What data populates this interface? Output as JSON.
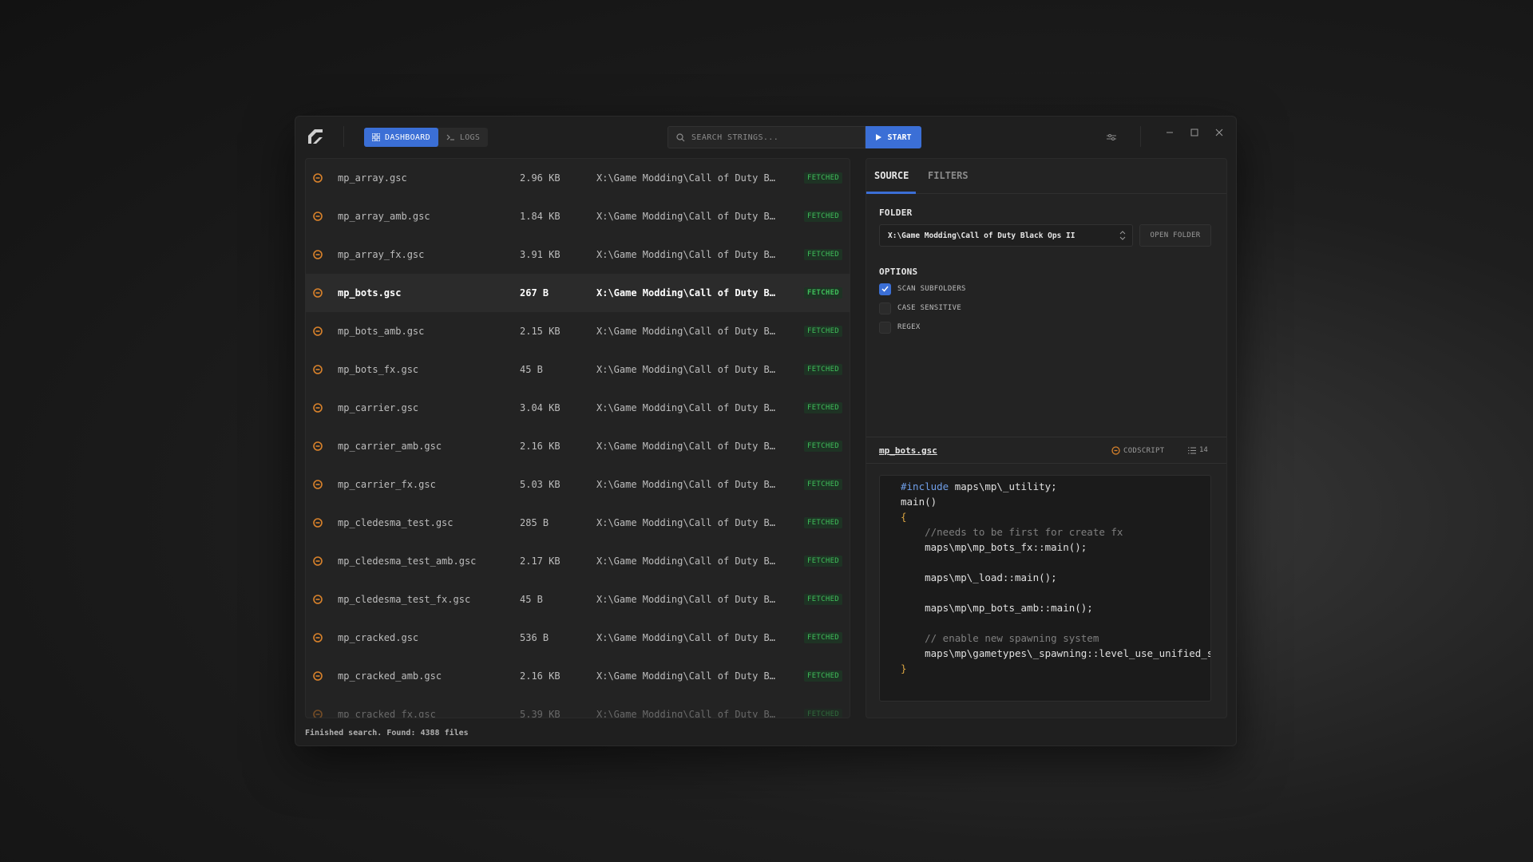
{
  "nav": {
    "dashboard_label": "DASHBOARD",
    "logs_label": "LOGS"
  },
  "search": {
    "placeholder": "SEARCH STRINGS...",
    "start_label": "START"
  },
  "files": [
    {
      "name": "mp_array.gsc",
      "size": "2.96 KB",
      "path": "X:\\Game Modding\\Call of Duty Black Ops II",
      "status": "FETCHED"
    },
    {
      "name": "mp_array_amb.gsc",
      "size": "1.84 KB",
      "path": "X:\\Game Modding\\Call of Duty Black Ops II",
      "status": "FETCHED"
    },
    {
      "name": "mp_array_fx.gsc",
      "size": "3.91 KB",
      "path": "X:\\Game Modding\\Call of Duty Black Ops II",
      "status": "FETCHED"
    },
    {
      "name": "mp_bots.gsc",
      "size": "267 B",
      "path": "X:\\Game Modding\\Call of Duty Black Ops II",
      "status": "FETCHED"
    },
    {
      "name": "mp_bots_amb.gsc",
      "size": "2.15 KB",
      "path": "X:\\Game Modding\\Call of Duty Black Ops II",
      "status": "FETCHED"
    },
    {
      "name": "mp_bots_fx.gsc",
      "size": "45 B",
      "path": "X:\\Game Modding\\Call of Duty Black Ops II",
      "status": "FETCHED"
    },
    {
      "name": "mp_carrier.gsc",
      "size": "3.04 KB",
      "path": "X:\\Game Modding\\Call of Duty Black Ops II",
      "status": "FETCHED"
    },
    {
      "name": "mp_carrier_amb.gsc",
      "size": "2.16 KB",
      "path": "X:\\Game Modding\\Call of Duty Black Ops II",
      "status": "FETCHED"
    },
    {
      "name": "mp_carrier_fx.gsc",
      "size": "5.03 KB",
      "path": "X:\\Game Modding\\Call of Duty Black Ops II",
      "status": "FETCHED"
    },
    {
      "name": "mp_cledesma_test.gsc",
      "size": "285 B",
      "path": "X:\\Game Modding\\Call of Duty Black Ops II",
      "status": "FETCHED"
    },
    {
      "name": "mp_cledesma_test_amb.gsc",
      "size": "2.17 KB",
      "path": "X:\\Game Modding\\Call of Duty Black Ops II",
      "status": "FETCHED"
    },
    {
      "name": "mp_cledesma_test_fx.gsc",
      "size": "45 B",
      "path": "X:\\Game Modding\\Call of Duty Black Ops II",
      "status": "FETCHED"
    },
    {
      "name": "mp_cracked.gsc",
      "size": "536 B",
      "path": "X:\\Game Modding\\Call of Duty Black Ops II",
      "status": "FETCHED"
    },
    {
      "name": "mp_cracked_amb.gsc",
      "size": "2.16 KB",
      "path": "X:\\Game Modding\\Call of Duty Black Ops II",
      "status": "FETCHED"
    },
    {
      "name": "mp_cracked_fx.gsc",
      "size": "5.39 KB",
      "path": "X:\\Game Modding\\Call of Duty Black Ops II",
      "status": "FETCHED"
    }
  ],
  "panel": {
    "tab_source": "SOURCE",
    "tab_filters": "FILTERS",
    "folder_label": "FOLDER",
    "folder_value": "X:\\Game Modding\\Call of Duty Black Ops II",
    "open_folder_label": "OPEN FOLDER",
    "options_label": "OPTIONS",
    "options": [
      {
        "label": "SCAN SUBFOLDERS",
        "checked": true
      },
      {
        "label": "CASE SENSITIVE",
        "checked": false
      },
      {
        "label": "REGEX",
        "checked": false
      }
    ]
  },
  "preview": {
    "file_name": "mp_bots.gsc",
    "language": "CODSCRIPT",
    "line_count": "14",
    "code": [
      {
        "text": "#include maps\\mp\\_utility;",
        "type": "include"
      },
      {
        "text": "main()",
        "type": "plain"
      },
      {
        "text": "{",
        "type": "brace"
      },
      {
        "text": "    //needs to be first for create fx",
        "type": "comment"
      },
      {
        "text": "    maps\\mp\\mp_bots_fx::main();",
        "type": "plain"
      },
      {
        "text": "",
        "type": "plain"
      },
      {
        "text": "    maps\\mp\\_load::main();",
        "type": "plain"
      },
      {
        "text": "",
        "type": "plain"
      },
      {
        "text": "    maps\\mp\\mp_bots_amb::main();",
        "type": "plain"
      },
      {
        "text": "",
        "type": "plain"
      },
      {
        "text": "    // enable new spawning system",
        "type": "comment"
      },
      {
        "text": "    maps\\mp\\gametypes\\_spawning::level_use_unified_spawning( true );",
        "type": "plain"
      },
      {
        "text": "}",
        "type": "brace"
      }
    ]
  },
  "status_text": "Finished search. Found: 4388 files",
  "colors": {
    "accent": "#3b6fd6",
    "fetched": "#3fbf5a",
    "file_icon": "#d9822b"
  }
}
